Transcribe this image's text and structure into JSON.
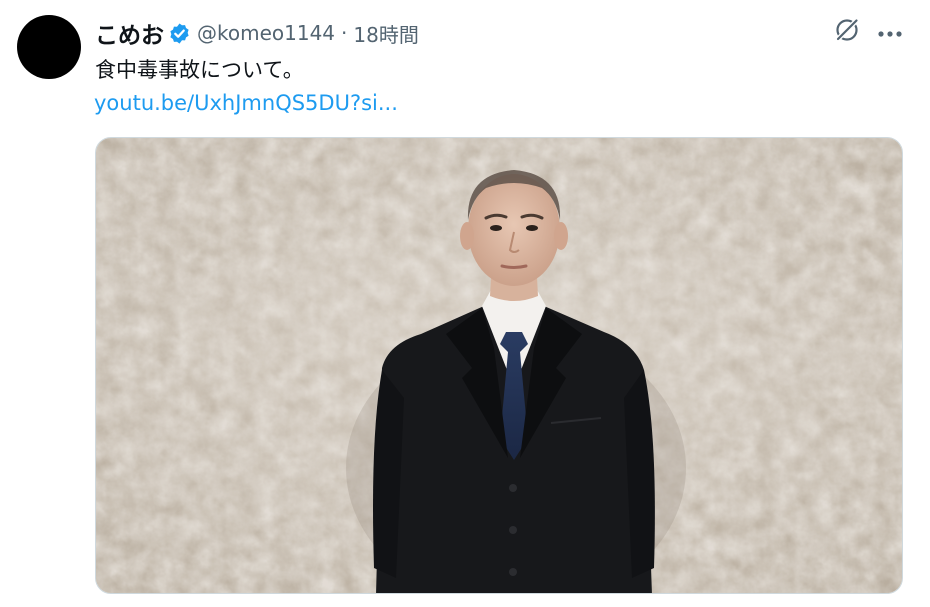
{
  "tweet": {
    "display_name": "こめお",
    "handle": "@komeo1144",
    "separator": "·",
    "time": "18時間",
    "text": "食中毒事故について。",
    "link_text": "youtu.be/UxhJmnQS5DU?si...",
    "avatar_color": "#000000",
    "verified_color": "#1d9bf0",
    "link_color": "#1d9bf0"
  },
  "actions": {
    "grok_icon": "grok-icon",
    "more_icon": "more-horizontal-icon"
  },
  "media": {
    "type": "video-thumbnail",
    "subject": "man-in-dark-suit",
    "background_color": "#c9bfb2"
  }
}
